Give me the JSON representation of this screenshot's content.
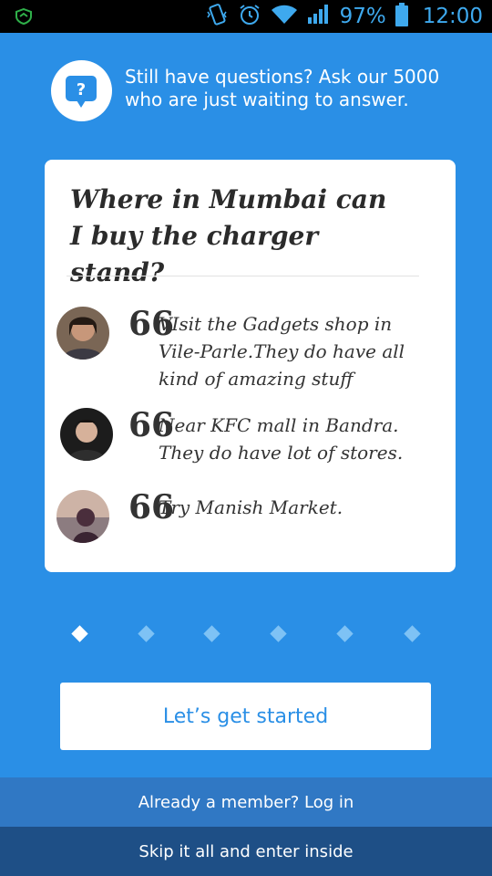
{
  "status_bar": {
    "battery_percent": "97%",
    "time": "12:00",
    "icons": [
      "shield-icon",
      "vibrate-icon",
      "alarm-icon",
      "wifi-icon",
      "signal-icon",
      "battery-icon"
    ]
  },
  "promo": {
    "text": "Still have questions? Ask our 5000 who are just waiting to answer.",
    "icon": "question-bubble-icon"
  },
  "card": {
    "question": "Where in Mumbai can I buy the charger stand?",
    "answers": [
      {
        "quote_mark": "66",
        "text": "VIsit the Gadgets shop in Vile-Parle.They do have all kind of amazing stuff",
        "avatar_color": "#5a4a3c"
      },
      {
        "quote_mark": "66",
        "text": "Near KFC mall in Bandra. They do have lot of stores.",
        "avatar_color": "#2c2a28"
      },
      {
        "quote_mark": "66",
        "text": "Try Manish Market.",
        "avatar_color": "#b08a7e"
      }
    ]
  },
  "pager": {
    "count": 6,
    "active_index": 0
  },
  "cta": {
    "label": "Let’s get started"
  },
  "login_bar": {
    "label": "Already a member? Log in"
  },
  "skip_bar": {
    "label": "Skip it all and enter inside"
  },
  "colors": {
    "background": "#2a8fe6",
    "login_bar": "#3078c4",
    "skip_bar": "#1e4f86",
    "accent": "#2a8fe6"
  }
}
